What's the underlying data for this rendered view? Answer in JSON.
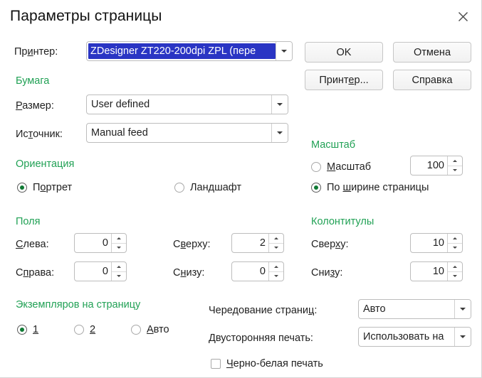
{
  "window": {
    "title": "Параметры страницы",
    "close_icon": "close-icon"
  },
  "printer": {
    "label_pre": "Пр",
    "label_accel": "и",
    "label_post": "нтер:",
    "value": "ZDesigner ZT220-200dpi ZPL (пере"
  },
  "buttons": {
    "ok": "OK",
    "cancel": "Отмена",
    "printer_pre": "Принт",
    "printer_accel": "е",
    "printer_post": "р...",
    "help": "Справка"
  },
  "paper": {
    "group": "Бумага",
    "size_accel": "Р",
    "size_label_post": "азмер:",
    "size_value": "User defined",
    "source_pre": "Ис",
    "source_accel": "т",
    "source_post": "очник:",
    "source_value": "Manual feed"
  },
  "orientation": {
    "group": "Ориентация",
    "portrait_pre": "П",
    "portrait_accel": "о",
    "portrait_post": "ртрет",
    "landscape_pre": "Лан",
    "landscape_accel": "д",
    "landscape_post": "шафт",
    "selected": "portrait"
  },
  "scale": {
    "group": "Масштаб",
    "scale_accel": "М",
    "scale_post": "асштаб",
    "scale_value": "100",
    "fit_pre": "По ",
    "fit_accel": "ш",
    "fit_post": "ирине страницы",
    "selected": "fit-width"
  },
  "margins": {
    "group": "Поля",
    "left_accel": "С",
    "left_post": "лева:",
    "left_value": "0",
    "right_pre": "С",
    "right_accel": "п",
    "right_post": "рава:",
    "right_value": "0",
    "top_pre": "С",
    "top_accel": "в",
    "top_post": "ерху:",
    "top_value": "2",
    "bottom_pre": "С",
    "bottom_accel": "н",
    "bottom_post": "изу:",
    "bottom_value": "0"
  },
  "headers_footers": {
    "group": "Колонтитулы",
    "top_pre": "Свер",
    "top_accel": "х",
    "top_post": "у:",
    "top_value": "10",
    "bottom_pre": "Сни",
    "bottom_accel": "з",
    "bottom_post": "у:",
    "bottom_value": "10"
  },
  "copies": {
    "group": "Экземпляров на страницу",
    "one": "1",
    "two": "2",
    "auto_accel": "А",
    "auto_post": "вто",
    "selected": "1"
  },
  "print_options": {
    "alternation_pre": "Чередование страни",
    "alternation_accel": "ц",
    "alternation_post": ":",
    "alternation_value": "Авто",
    "duplex_label": "Двусторонняя печать:",
    "duplex_value": "Использовать на",
    "bw_accel": "Ч",
    "bw_post": "ерно-белая печать",
    "bw_checked": false
  },
  "colors": {
    "group_heading": "#21a155",
    "selection": "#2a35c4",
    "radio_dot": "#0f7a34",
    "text": "#1f1f1f"
  }
}
